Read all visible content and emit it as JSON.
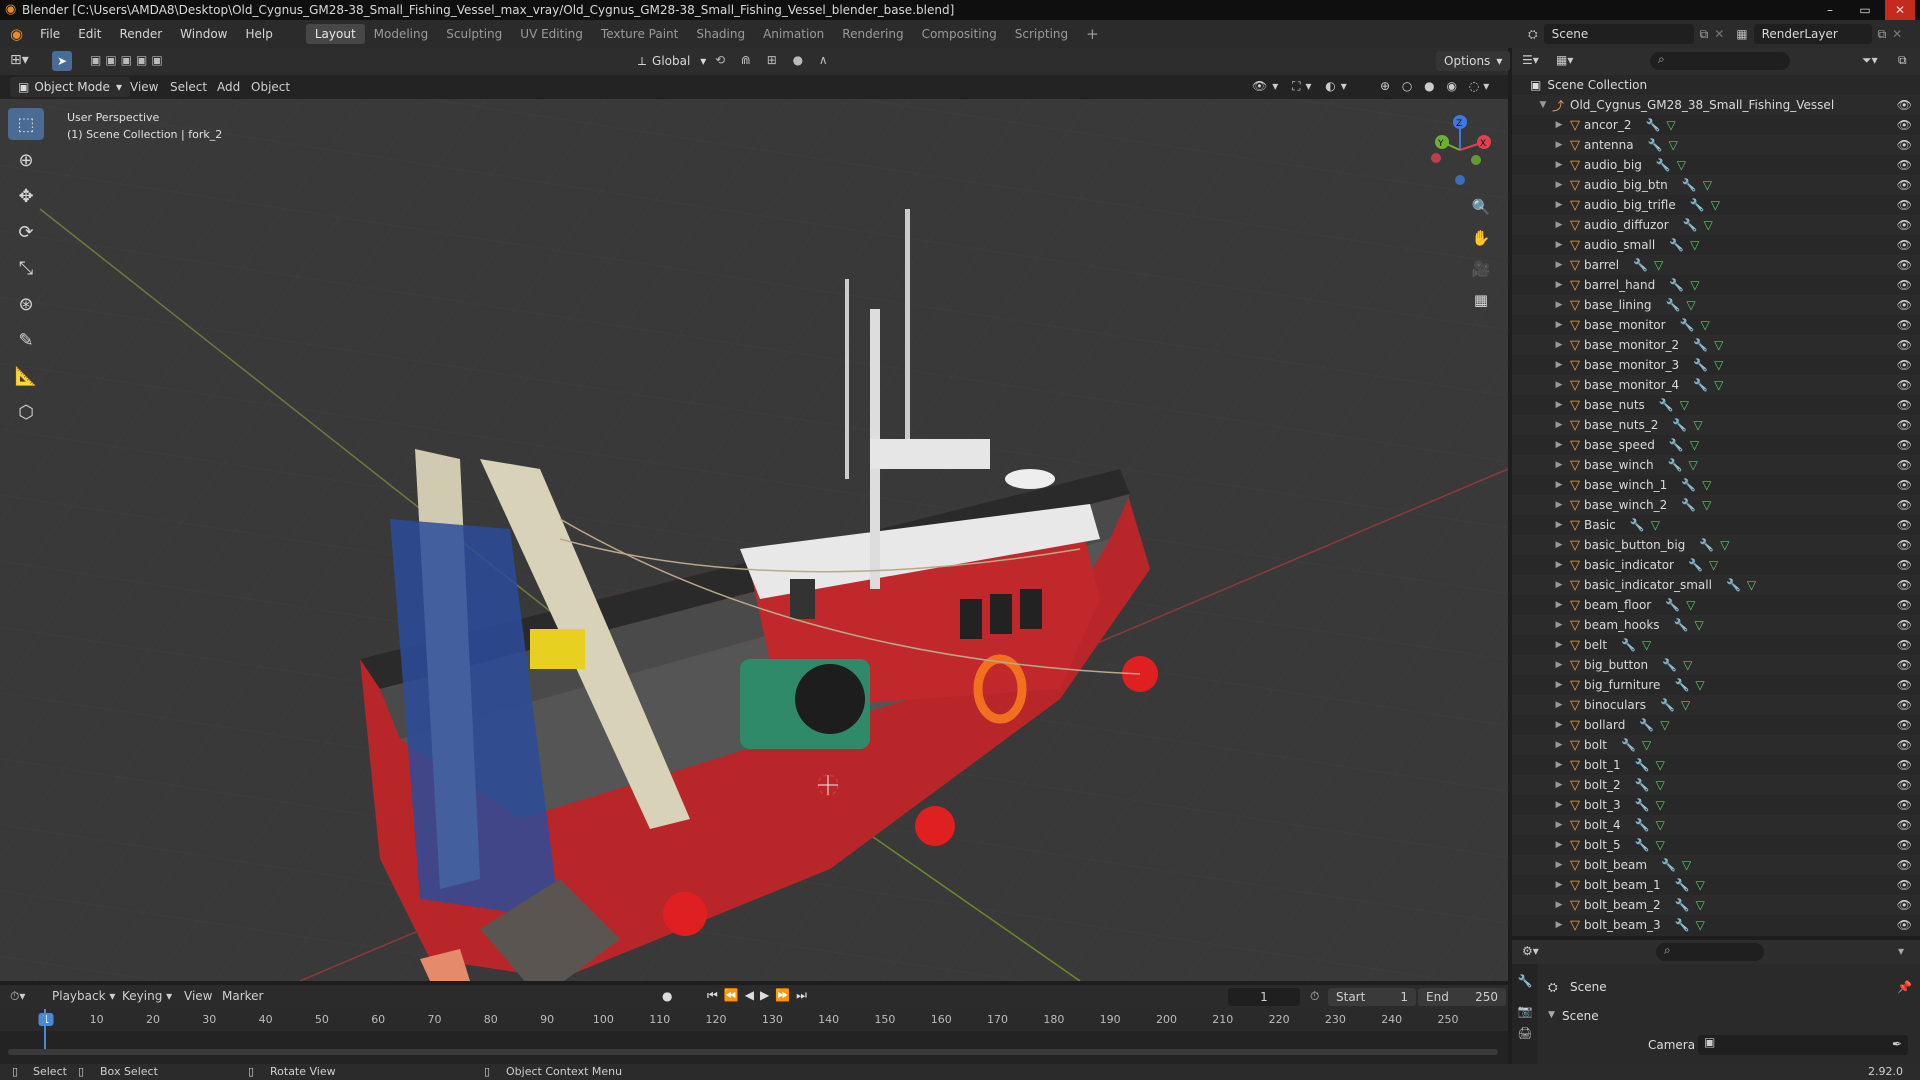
{
  "window": {
    "title": "Blender [C:\\Users\\AMDA8\\Desktop\\Old_Cygnus_GM28-38_Small_Fishing_Vessel_max_vray/Old_Cygnus_GM28-38_Small_Fishing_Vessel_blender_base.blend]"
  },
  "menu": [
    "File",
    "Edit",
    "Render",
    "Window",
    "Help"
  ],
  "workspaces": [
    "Layout",
    "Modeling",
    "Sculpting",
    "UV Editing",
    "Texture Paint",
    "Shading",
    "Animation",
    "Rendering",
    "Compositing",
    "Scripting"
  ],
  "active_workspace": "Layout",
  "scene_selector": "Scene",
  "renderlayer_selector": "RenderLayer",
  "viewport": {
    "transform_orientation": "Global",
    "options_label": "Options",
    "mode": "Object Mode",
    "menus": [
      "View",
      "Select",
      "Add",
      "Object"
    ],
    "overlay_line1": "User Perspective",
    "overlay_line2": "(1) Scene Collection | fork_2",
    "gizmo_axes": {
      "x": "X",
      "y": "Y",
      "z": "Z"
    }
  },
  "outliner": {
    "root": "Scene Collection",
    "collection": "Old_Cygnus_GM28_38_Small_Fishing_Vessel",
    "items": [
      "ancor_2",
      "antenna",
      "audio_big",
      "audio_big_btn",
      "audio_big_trifle",
      "audio_diffuzor",
      "audio_small",
      "barrel",
      "barrel_hand",
      "base_lining",
      "base_monitor",
      "base_monitor_2",
      "base_monitor_3",
      "base_monitor_4",
      "base_nuts",
      "base_nuts_2",
      "base_speed",
      "base_winch",
      "base_winch_1",
      "base_winch_2",
      "Basic",
      "basic_button_big",
      "basic_indicator",
      "basic_indicator_small",
      "beam_floor",
      "beam_hooks",
      "belt",
      "big_button",
      "big_furniture",
      "binoculars",
      "bollard",
      "bolt",
      "bolt_1",
      "bolt_2",
      "bolt_3",
      "bolt_4",
      "bolt_5",
      "bolt_beam",
      "bolt_beam_1",
      "bolt_beam_2",
      "bolt_beam_3"
    ]
  },
  "properties": {
    "scene_label": "Scene",
    "panel_label": "Scene",
    "camera_label": "Camera"
  },
  "timeline": {
    "menus": [
      "Playback",
      "Keying",
      "View",
      "Marker"
    ],
    "current_frame": "1",
    "start_label": "Start",
    "start_value": "1",
    "end_label": "End",
    "end_value": "250",
    "ticks": [
      "1",
      "10",
      "20",
      "30",
      "40",
      "50",
      "60",
      "70",
      "80",
      "90",
      "100",
      "110",
      "120",
      "130",
      "140",
      "150",
      "160",
      "170",
      "180",
      "190",
      "200",
      "210",
      "220",
      "230",
      "240",
      "250"
    ]
  },
  "status": {
    "select": "Select",
    "box_select": "Box Select",
    "rotate_view": "Rotate View",
    "context_menu": "Object Context Menu",
    "version": "2.92.0"
  },
  "colors": {
    "accent_blue": "#4a6b94",
    "hull_red": "#b8262a",
    "mesh_orange": "#f0a050"
  }
}
